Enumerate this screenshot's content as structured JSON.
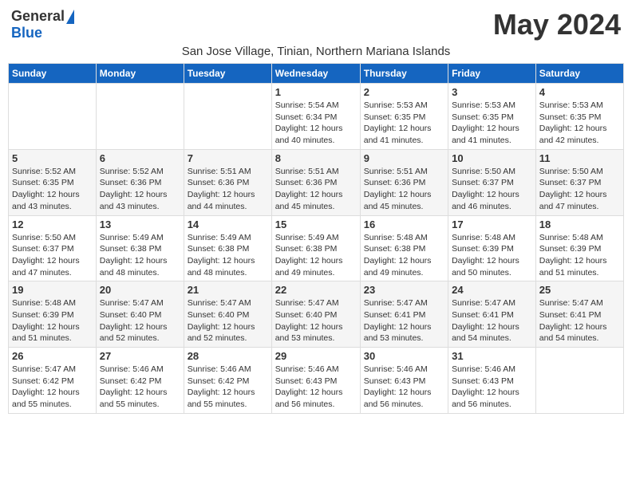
{
  "logo": {
    "general": "General",
    "blue": "Blue"
  },
  "title": "May 2024",
  "subtitle": "San Jose Village, Tinian, Northern Mariana Islands",
  "days_of_week": [
    "Sunday",
    "Monday",
    "Tuesday",
    "Wednesday",
    "Thursday",
    "Friday",
    "Saturday"
  ],
  "weeks": [
    [
      {
        "day": "",
        "info": ""
      },
      {
        "day": "",
        "info": ""
      },
      {
        "day": "",
        "info": ""
      },
      {
        "day": "1",
        "info": "Sunrise: 5:54 AM\nSunset: 6:34 PM\nDaylight: 12 hours\nand 40 minutes."
      },
      {
        "day": "2",
        "info": "Sunrise: 5:53 AM\nSunset: 6:35 PM\nDaylight: 12 hours\nand 41 minutes."
      },
      {
        "day": "3",
        "info": "Sunrise: 5:53 AM\nSunset: 6:35 PM\nDaylight: 12 hours\nand 41 minutes."
      },
      {
        "day": "4",
        "info": "Sunrise: 5:53 AM\nSunset: 6:35 PM\nDaylight: 12 hours\nand 42 minutes."
      }
    ],
    [
      {
        "day": "5",
        "info": "Sunrise: 5:52 AM\nSunset: 6:35 PM\nDaylight: 12 hours\nand 43 minutes."
      },
      {
        "day": "6",
        "info": "Sunrise: 5:52 AM\nSunset: 6:36 PM\nDaylight: 12 hours\nand 43 minutes."
      },
      {
        "day": "7",
        "info": "Sunrise: 5:51 AM\nSunset: 6:36 PM\nDaylight: 12 hours\nand 44 minutes."
      },
      {
        "day": "8",
        "info": "Sunrise: 5:51 AM\nSunset: 6:36 PM\nDaylight: 12 hours\nand 45 minutes."
      },
      {
        "day": "9",
        "info": "Sunrise: 5:51 AM\nSunset: 6:36 PM\nDaylight: 12 hours\nand 45 minutes."
      },
      {
        "day": "10",
        "info": "Sunrise: 5:50 AM\nSunset: 6:37 PM\nDaylight: 12 hours\nand 46 minutes."
      },
      {
        "day": "11",
        "info": "Sunrise: 5:50 AM\nSunset: 6:37 PM\nDaylight: 12 hours\nand 47 minutes."
      }
    ],
    [
      {
        "day": "12",
        "info": "Sunrise: 5:50 AM\nSunset: 6:37 PM\nDaylight: 12 hours\nand 47 minutes."
      },
      {
        "day": "13",
        "info": "Sunrise: 5:49 AM\nSunset: 6:38 PM\nDaylight: 12 hours\nand 48 minutes."
      },
      {
        "day": "14",
        "info": "Sunrise: 5:49 AM\nSunset: 6:38 PM\nDaylight: 12 hours\nand 48 minutes."
      },
      {
        "day": "15",
        "info": "Sunrise: 5:49 AM\nSunset: 6:38 PM\nDaylight: 12 hours\nand 49 minutes."
      },
      {
        "day": "16",
        "info": "Sunrise: 5:48 AM\nSunset: 6:38 PM\nDaylight: 12 hours\nand 49 minutes."
      },
      {
        "day": "17",
        "info": "Sunrise: 5:48 AM\nSunset: 6:39 PM\nDaylight: 12 hours\nand 50 minutes."
      },
      {
        "day": "18",
        "info": "Sunrise: 5:48 AM\nSunset: 6:39 PM\nDaylight: 12 hours\nand 51 minutes."
      }
    ],
    [
      {
        "day": "19",
        "info": "Sunrise: 5:48 AM\nSunset: 6:39 PM\nDaylight: 12 hours\nand 51 minutes."
      },
      {
        "day": "20",
        "info": "Sunrise: 5:47 AM\nSunset: 6:40 PM\nDaylight: 12 hours\nand 52 minutes."
      },
      {
        "day": "21",
        "info": "Sunrise: 5:47 AM\nSunset: 6:40 PM\nDaylight: 12 hours\nand 52 minutes."
      },
      {
        "day": "22",
        "info": "Sunrise: 5:47 AM\nSunset: 6:40 PM\nDaylight: 12 hours\nand 53 minutes."
      },
      {
        "day": "23",
        "info": "Sunrise: 5:47 AM\nSunset: 6:41 PM\nDaylight: 12 hours\nand 53 minutes."
      },
      {
        "day": "24",
        "info": "Sunrise: 5:47 AM\nSunset: 6:41 PM\nDaylight: 12 hours\nand 54 minutes."
      },
      {
        "day": "25",
        "info": "Sunrise: 5:47 AM\nSunset: 6:41 PM\nDaylight: 12 hours\nand 54 minutes."
      }
    ],
    [
      {
        "day": "26",
        "info": "Sunrise: 5:47 AM\nSunset: 6:42 PM\nDaylight: 12 hours\nand 55 minutes."
      },
      {
        "day": "27",
        "info": "Sunrise: 5:46 AM\nSunset: 6:42 PM\nDaylight: 12 hours\nand 55 minutes."
      },
      {
        "day": "28",
        "info": "Sunrise: 5:46 AM\nSunset: 6:42 PM\nDaylight: 12 hours\nand 55 minutes."
      },
      {
        "day": "29",
        "info": "Sunrise: 5:46 AM\nSunset: 6:43 PM\nDaylight: 12 hours\nand 56 minutes."
      },
      {
        "day": "30",
        "info": "Sunrise: 5:46 AM\nSunset: 6:43 PM\nDaylight: 12 hours\nand 56 minutes."
      },
      {
        "day": "31",
        "info": "Sunrise: 5:46 AM\nSunset: 6:43 PM\nDaylight: 12 hours\nand 56 minutes."
      },
      {
        "day": "",
        "info": ""
      }
    ]
  ]
}
